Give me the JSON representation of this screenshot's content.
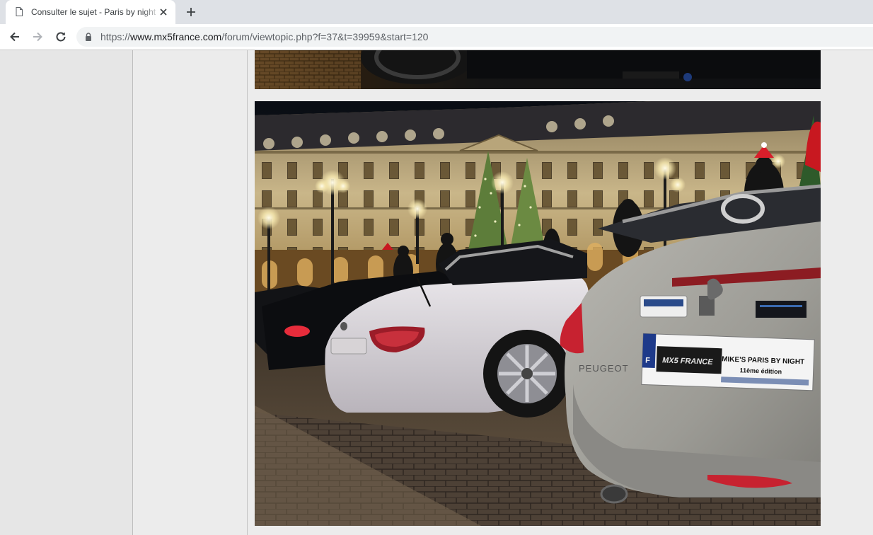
{
  "browser": {
    "tab": {
      "title": "Consulter le sujet - Paris by night",
      "icon": "document-icon"
    },
    "new_tab_icon": "plus-icon",
    "nav": {
      "back_icon": "arrow-left-icon",
      "forward_icon": "arrow-right-icon",
      "reload_icon": "reload-icon"
    },
    "address": {
      "scheme": "https://",
      "host": "www.mx5france.com",
      "path": "/forum/viewtopic.php?f=37&t=39959&start=120",
      "secure_icon": "lock-icon"
    }
  },
  "post": {
    "images": [
      {
        "name": "night-car-photo-cropped"
      },
      {
        "name": "place-vendome-mx5-photo",
        "plate_sticker": {
          "line1": "MIKE'S PARIS BY NIGHT",
          "line2": "11ème édition",
          "logo": "MX5 FRANCE",
          "country": "F"
        },
        "car_badge": "PEUGEOT"
      }
    ]
  },
  "colors": {
    "tabstrip": "#dee1e6",
    "omnibox": "#f1f3f4",
    "page_bg": "#ececec"
  }
}
